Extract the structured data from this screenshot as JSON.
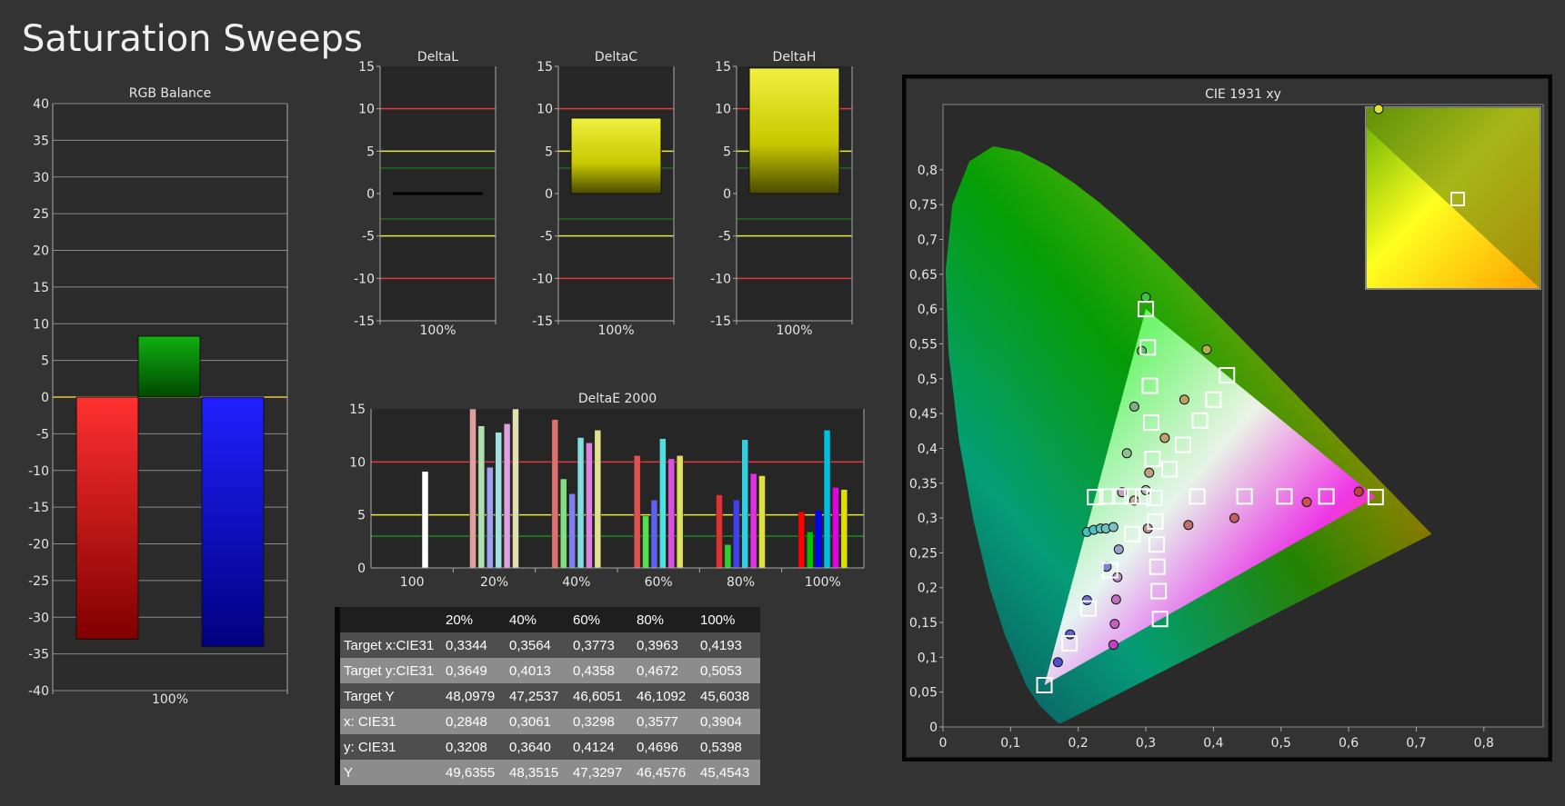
{
  "page_title": "Saturation Sweeps",
  "chart_data": [
    {
      "id": "rgb-balance",
      "type": "bar",
      "title": "RGB Balance",
      "categories": [
        "100%"
      ],
      "series": [
        {
          "color": "#ff0000",
          "values": [
            -33
          ]
        },
        {
          "color": "#00a000",
          "values": [
            8.3
          ]
        },
        {
          "color": "#1010ff",
          "values": [
            -34
          ]
        }
      ],
      "ylim": [
        -40,
        40
      ],
      "yticks": [
        -40,
        -35,
        -30,
        -25,
        -20,
        -15,
        -10,
        -5,
        0,
        5,
        10,
        15,
        20,
        25,
        30,
        35,
        40
      ],
      "grid": true
    },
    {
      "id": "delta-l",
      "type": "bar",
      "title": "DeltaL",
      "categories": [
        "100%"
      ],
      "values": [
        0
      ],
      "ylim": [
        -15,
        15
      ],
      "yticks": [
        -15,
        -10,
        -5,
        0,
        5,
        10,
        15
      ],
      "thresholds": [
        10,
        5,
        3,
        -3,
        -5,
        -10
      ]
    },
    {
      "id": "delta-c",
      "type": "bar",
      "title": "DeltaC",
      "categories": [
        "100%"
      ],
      "values": [
        8.9
      ],
      "ylim": [
        -15,
        15
      ],
      "yticks": [
        -15,
        -10,
        -5,
        0,
        5,
        10,
        15
      ],
      "thresholds": [
        10,
        5,
        3,
        -3,
        -5,
        -10
      ]
    },
    {
      "id": "delta-h",
      "type": "bar",
      "title": "DeltaH",
      "categories": [
        "100%"
      ],
      "values": [
        14.8
      ],
      "ylim": [
        -15,
        15
      ],
      "yticks": [
        -15,
        -10,
        -5,
        0,
        5,
        10,
        15
      ],
      "thresholds": [
        10,
        5,
        3,
        -3,
        -5,
        -10
      ]
    },
    {
      "id": "delta-e-2000",
      "type": "bar",
      "title": "DeltaE 2000",
      "categories": [
        "100",
        "20%",
        "40%",
        "60%",
        "80%",
        "100%"
      ],
      "groups": [
        {
          "label": "100",
          "values": [
            9.1
          ],
          "colors": [
            "#ffffff"
          ]
        },
        {
          "label": "20%",
          "values": [
            15,
            13.4,
            9.5,
            12.8,
            13.6,
            15
          ],
          "colors": [
            "#e0a0a0",
            "#b0e0b0",
            "#a0a0f0",
            "#a0e0e0",
            "#e0a0e0",
            "#e0e0b0"
          ]
        },
        {
          "label": "40%",
          "values": [
            14,
            8.4,
            7,
            12.3,
            11.8,
            13
          ],
          "colors": [
            "#e07070",
            "#80e080",
            "#8080f0",
            "#80e0e0",
            "#e080e0",
            "#e0e090"
          ]
        },
        {
          "label": "60%",
          "values": [
            10.6,
            4.9,
            6.4,
            12.2,
            10.3,
            10.6
          ],
          "colors": [
            "#e05050",
            "#50e050",
            "#6060f0",
            "#50e0e0",
            "#e050e0",
            "#e0e060"
          ]
        },
        {
          "label": "80%",
          "values": [
            6.9,
            2.2,
            6.4,
            12.1,
            8.9,
            8.7
          ],
          "colors": [
            "#e03030",
            "#30d030",
            "#4040f0",
            "#30d0e0",
            "#e030e0",
            "#e0e040"
          ]
        },
        {
          "label": "100%",
          "values": [
            5.3,
            3.4,
            5.4,
            13,
            7.6,
            7.4
          ],
          "colors": [
            "#ff0000",
            "#00c000",
            "#0000ff",
            "#00c0e0",
            "#e000e0",
            "#e0e000"
          ]
        }
      ],
      "ylim": [
        0,
        15
      ],
      "yticks": [
        0,
        5,
        10,
        15
      ],
      "thresholds": [
        10,
        5,
        3
      ]
    },
    {
      "id": "cie-1931",
      "type": "scatter",
      "title": "CIE 1931 xy",
      "xlim": [
        0,
        0.85
      ],
      "ylim": [
        0,
        0.85
      ],
      "xticks": [
        0,
        0.1,
        0.2,
        0.3,
        0.4,
        0.5,
        0.6,
        0.7,
        0.8
      ],
      "xtick_labels": [
        "0",
        "0,1",
        "0,2",
        "0,3",
        "0,4",
        "0,5",
        "0,6",
        "0,7",
        "0,8"
      ],
      "yticks": [
        0,
        0.05,
        0.1,
        0.15,
        0.2,
        0.25,
        0.3,
        0.35,
        0.4,
        0.45,
        0.5,
        0.55,
        0.6,
        0.65,
        0.7,
        0.75,
        0.8
      ],
      "ytick_labels": [
        "0",
        "0,05",
        "0,1",
        "0,15",
        "0,2",
        "0,25",
        "0,3",
        "0,35",
        "0,4",
        "0,45",
        "0,5",
        "0,55",
        "0,6",
        "0,65",
        "0,7",
        "0,75",
        "0,8"
      ],
      "gamut_triangle": [
        [
          0.64,
          0.33
        ],
        [
          0.3,
          0.6
        ],
        [
          0.15,
          0.06
        ]
      ],
      "targets": [
        [
          0.64,
          0.33
        ],
        [
          0.567,
          0.331
        ],
        [
          0.505,
          0.331
        ],
        [
          0.446,
          0.331
        ],
        [
          0.376,
          0.331
        ],
        [
          0.3127,
          0.329
        ],
        [
          0.3,
          0.6
        ],
        [
          0.303,
          0.545
        ],
        [
          0.306,
          0.49
        ],
        [
          0.308,
          0.437
        ],
        [
          0.31,
          0.385
        ],
        [
          0.15,
          0.06
        ],
        [
          0.187,
          0.12
        ],
        [
          0.215,
          0.17
        ],
        [
          0.247,
          0.225
        ],
        [
          0.28,
          0.277
        ],
        [
          0.42,
          0.505
        ],
        [
          0.4,
          0.47
        ],
        [
          0.38,
          0.44
        ],
        [
          0.355,
          0.405
        ],
        [
          0.335,
          0.37
        ],
        [
          0.225,
          0.33
        ],
        [
          0.243,
          0.331
        ],
        [
          0.262,
          0.331
        ],
        [
          0.28,
          0.331
        ],
        [
          0.296,
          0.331
        ],
        [
          0.321,
          0.155
        ],
        [
          0.319,
          0.195
        ],
        [
          0.317,
          0.23
        ],
        [
          0.316,
          0.262
        ],
        [
          0.314,
          0.295
        ]
      ],
      "measured": [
        {
          "x": 0.615,
          "y": 0.338,
          "color": "#c04040"
        },
        {
          "x": 0.538,
          "y": 0.323,
          "color": "#d05050"
        },
        {
          "x": 0.431,
          "y": 0.3,
          "color": "#c06060"
        },
        {
          "x": 0.363,
          "y": 0.29,
          "color": "#c07070"
        },
        {
          "x": 0.303,
          "y": 0.285,
          "color": "#c09090"
        },
        {
          "x": 0.3,
          "y": 0.617,
          "color": "#40c040"
        },
        {
          "x": 0.294,
          "y": 0.54,
          "color": "#60c060"
        },
        {
          "x": 0.283,
          "y": 0.46,
          "color": "#80b080"
        },
        {
          "x": 0.272,
          "y": 0.393,
          "color": "#90c090"
        },
        {
          "x": 0.3,
          "y": 0.34,
          "color": "#b0b0b0"
        },
        {
          "x": 0.39,
          "y": 0.542,
          "color": "#b0b040"
        },
        {
          "x": 0.357,
          "y": 0.47,
          "color": "#c0a060"
        },
        {
          "x": 0.328,
          "y": 0.415,
          "color": "#c0a070"
        },
        {
          "x": 0.305,
          "y": 0.365,
          "color": "#c0a080"
        },
        {
          "x": 0.283,
          "y": 0.325,
          "color": "#c0b0a0"
        },
        {
          "x": 0.213,
          "y": 0.28,
          "color": "#40c0c0"
        },
        {
          "x": 0.223,
          "y": 0.283,
          "color": "#50c0c0"
        },
        {
          "x": 0.233,
          "y": 0.285,
          "color": "#60c0c0"
        },
        {
          "x": 0.241,
          "y": 0.285,
          "color": "#70c0c0"
        },
        {
          "x": 0.252,
          "y": 0.287,
          "color": "#80c0c0"
        },
        {
          "x": 0.17,
          "y": 0.093,
          "color": "#5050d0"
        },
        {
          "x": 0.188,
          "y": 0.133,
          "color": "#6060d0"
        },
        {
          "x": 0.213,
          "y": 0.182,
          "color": "#7070d0"
        },
        {
          "x": 0.242,
          "y": 0.23,
          "color": "#8080d0"
        },
        {
          "x": 0.26,
          "y": 0.255,
          "color": "#a0a0d0"
        },
        {
          "x": 0.252,
          "y": 0.118,
          "color": "#c040c0"
        },
        {
          "x": 0.254,
          "y": 0.148,
          "color": "#c060c0"
        },
        {
          "x": 0.256,
          "y": 0.183,
          "color": "#c070c0"
        },
        {
          "x": 0.258,
          "y": 0.215,
          "color": "#c090c0"
        },
        {
          "x": 0.265,
          "y": 0.337,
          "color": "#c0a0c0"
        },
        {
          "x": 0.617,
          "y": 0.837,
          "color": "#e0e040"
        }
      ],
      "inset_target": [
        0.4193,
        0.5053
      ]
    }
  ],
  "table": {
    "headers": [
      "",
      "20%",
      "40%",
      "60%",
      "80%",
      "100%"
    ],
    "rows": [
      {
        "label": "Target x:CIE31",
        "values": [
          "0,3344",
          "0,3564",
          "0,3773",
          "0,3963",
          "0,4193"
        ]
      },
      {
        "label": "Target y:CIE31",
        "values": [
          "0,3649",
          "0,4013",
          "0,4358",
          "0,4672",
          "0,5053"
        ]
      },
      {
        "label": "Target Y",
        "values": [
          "48,0979",
          "47,2537",
          "46,6051",
          "46,1092",
          "45,6038"
        ]
      },
      {
        "label": "x: CIE31",
        "values": [
          "0,2848",
          "0,3061",
          "0,3298",
          "0,3577",
          "0,3904"
        ]
      },
      {
        "label": "y: CIE31",
        "values": [
          "0,3208",
          "0,3640",
          "0,4124",
          "0,4696",
          "0,5398"
        ]
      },
      {
        "label": "Y",
        "values": [
          "49,6355",
          "48,3515",
          "47,3297",
          "46,4576",
          "45,4543"
        ]
      }
    ]
  }
}
